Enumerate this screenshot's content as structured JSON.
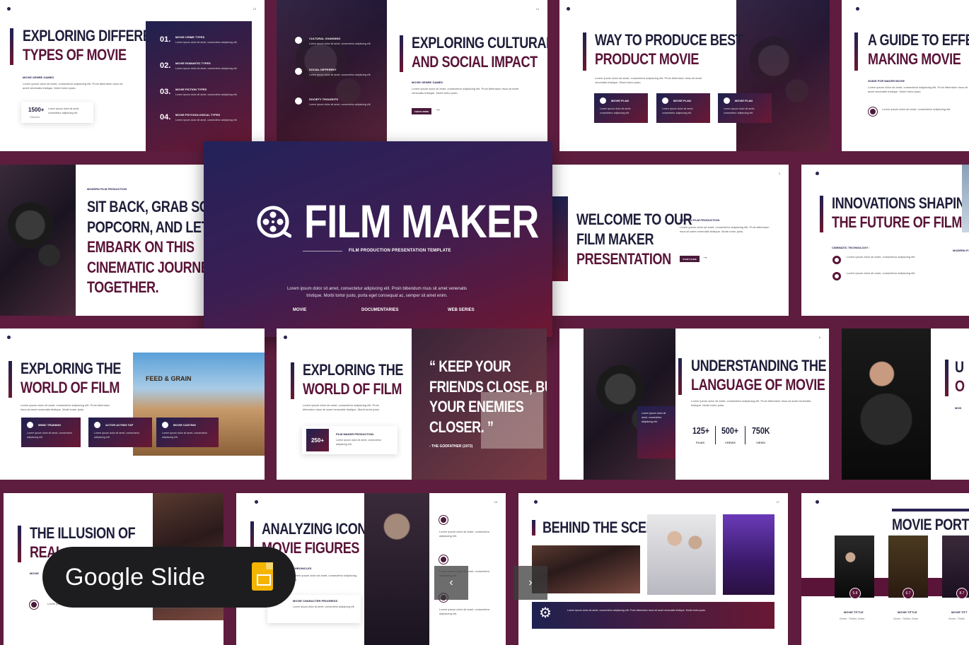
{
  "badge": {
    "label": "Google Slide",
    "icon": "google-slides-icon"
  },
  "hero": {
    "title": "FILM MAKER",
    "subtitle": "FILM PRODUCTION PRESENTATION TEMPLATE",
    "body": "Lorem ipsum dolor sit amet, consectetur adipiscing elit. Proin bibendum risus sit amet venenatis tristique. Morbi tortor justo, porta eget consequat ac, semper sit amet enim.",
    "nav": [
      "MOVIE",
      "DOCUMENTARIES",
      "WEB SERIES"
    ]
  },
  "slides": {
    "s1": {
      "line1": "EXPLORING DIFFERENT",
      "line2": "TYPES OF MOVIE",
      "label": "MOVIE GENRE GAMES",
      "stat": "1500+",
      "stat_lbl": "Viewers",
      "items": [
        {
          "num": "01.",
          "title": "MOVIE CRIME TYPES"
        },
        {
          "num": "02.",
          "title": "MOVIE ROMANTIC TYPES"
        },
        {
          "num": "03.",
          "title": "MOVIE FICTION TYPES"
        },
        {
          "num": "04.",
          "title": "MOVIE PSYCHOLOGICAL TYPES"
        }
      ],
      "page": "13"
    },
    "s2": {
      "line1": "EXPLORING CULTURAL",
      "line2": "AND SOCIAL IMPACT",
      "label": "MOVIE GENRE GAMES",
      "btn": "CHECK MORE",
      "items": [
        "CULTURAL CHANGING",
        "SOCIAL DIFFERENT",
        "SOCIETY THOUGHTS"
      ],
      "page": "14"
    },
    "s3": {
      "line1": "WAY TO PRODUCE BEST",
      "line2": "PRODUCT MOVIE",
      "cards": [
        "MOVIE PLAN",
        "MOVIE PLAN",
        "MOVIE PLAN"
      ]
    },
    "s4": {
      "line1": "A GUIDE TO EFFECTIVE",
      "line2": "MAKING MOVIE",
      "label": "GUIDE FOR MAKER MOVIE"
    },
    "s5": {
      "label": "MODERN FILM PRODUCTION",
      "lines": [
        "SIT BACK, GRAB SOME",
        "POPCORN, AND LET'S",
        "EMBARK ON THIS",
        "CINEMATIC JOURNEY",
        "TOGETHER."
      ]
    },
    "s6": {
      "line1": "WELCOME TO OUR",
      "line2": "FILM MAKER",
      "line3": "PRESENTATION",
      "label": "MODERN FILM PRODUCTION",
      "btn": "START SLIDE",
      "page": "3"
    },
    "s7": {
      "line1": "INNOVATIONS SHAPING",
      "line2": "THE FUTURE OF FILM",
      "label": "CINEMATIC TECHNOLOGY :",
      "side_label": "MODERN FI"
    },
    "s8": {
      "line1": "EXPLORING THE",
      "line2": "WORLD OF FILM",
      "cards": [
        "MIMIC TRAINING",
        "ACTOR ACTING TAP",
        "MOVIE CASTING"
      ],
      "sign": "FEED & GRAIN"
    },
    "s9": {
      "line1": "EXPLORING THE",
      "line2": "WORLD OF FILM",
      "stat": "250+",
      "stat_label": "FILM MAKER PRODUCTION"
    },
    "s10": {
      "quote": [
        "“ KEEP YOUR",
        "FRIENDS CLOSE, BUT",
        "YOUR ENEMIES",
        "CLOSER. ”"
      ],
      "cite": "- THE GODFATHER (1972)"
    },
    "s11": {
      "line1": "UNDERSTANDING THE",
      "line2": "LANGUAGE OF MOVIE",
      "stats": [
        {
          "n": "125+",
          "l": "FILMS"
        },
        {
          "n": "500+",
          "l": "CREWS"
        },
        {
          "n": "750K",
          "l": "VIEWS"
        }
      ],
      "page": "6"
    },
    "s12": {
      "line1": "U",
      "line2": "O",
      "side": "MOD"
    },
    "s13": {
      "line1": "THE ILLUSION OF",
      "line2": "REAL",
      "label": "MOVIE"
    },
    "s14": {
      "line1": "ANALYZING ICONIC",
      "line2": "MOVIE FIGURES",
      "l1": "CHRONICLES",
      "l2": "MOVIE CHARACTER PROGRESS",
      "page": "16"
    },
    "s15": {
      "line1": "BEHIND THE SCENE",
      "page": "17"
    },
    "s16": {
      "line1": "MOVIE PORTFOL",
      "items": [
        {
          "rating": "5.8",
          "title": "MOVIE TITTLE",
          "genre": "Genre : Thriller, Crime"
        },
        {
          "rating": "6.7",
          "title": "MOVIE TITTLE",
          "genre": "Genre : Thriller, Crime"
        },
        {
          "rating": "8.7",
          "title": "MOVIE TITT",
          "genre": "Genre : Thrille"
        }
      ]
    }
  },
  "logo_text": "FILM MAKER",
  "lorem_short": "Lorem ipsum dolor sit amet, consectetur adipiscing elit. Proin bibendum risus sit amet venenatis tristique. Morbi tortor justo.",
  "lorem_tiny": "Lorem ipsum dolor sit amet, consectetur adipiscing elit.",
  "colors": {
    "background": "#5e1d3e",
    "navy": "#1f2150",
    "wine": "#6a1833",
    "badge": "#1d1d1f",
    "slides_icon": "#f4b400"
  }
}
